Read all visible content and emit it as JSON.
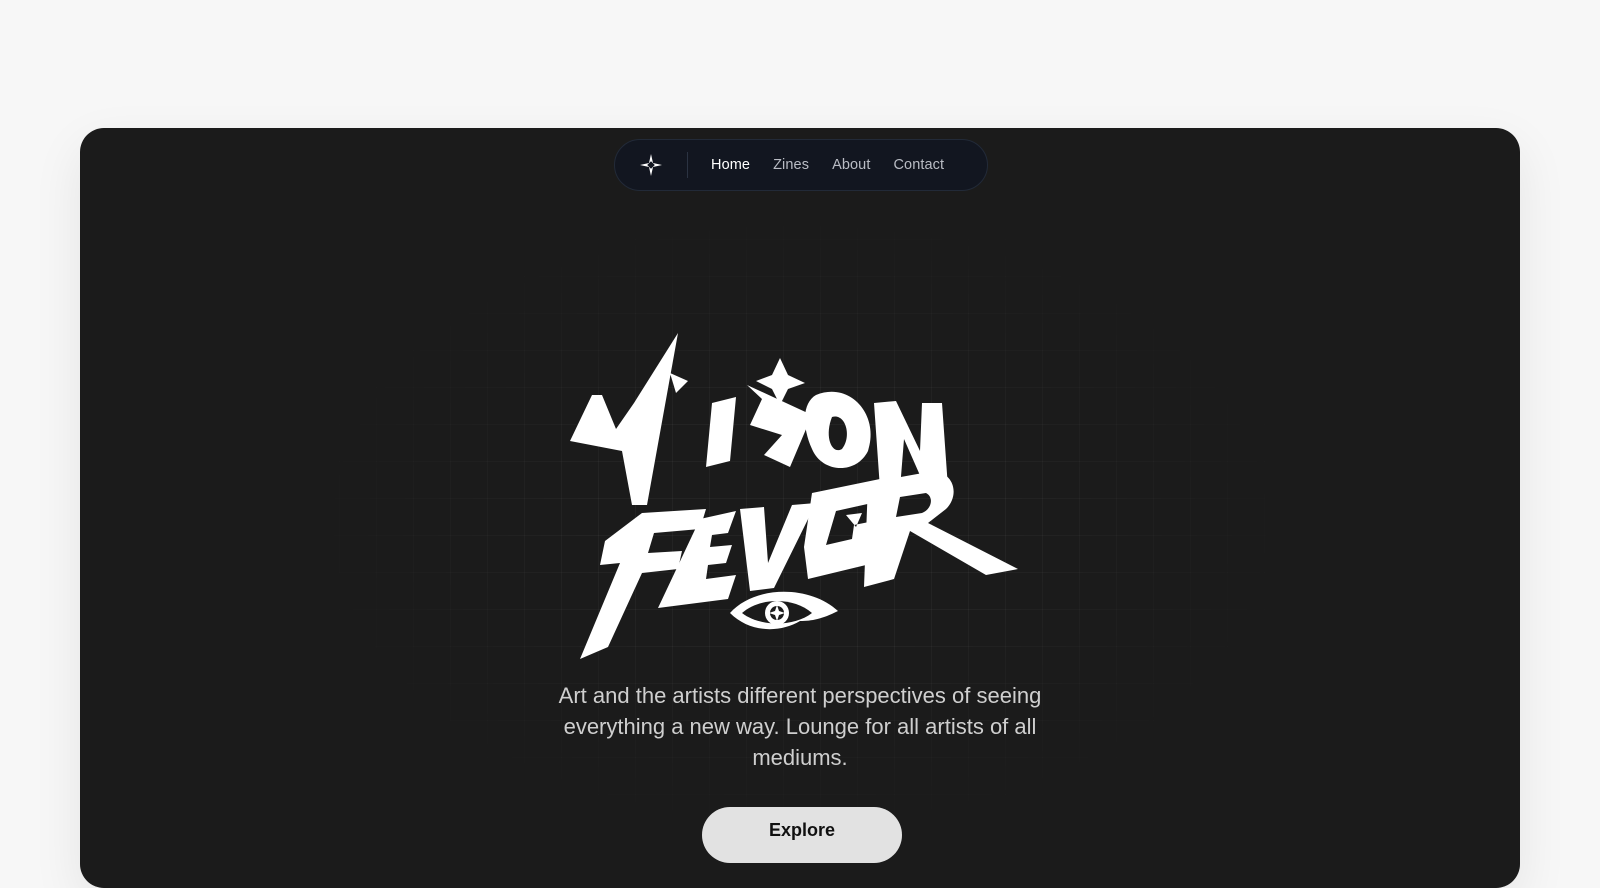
{
  "nav": {
    "logo_icon": "four-point-star-icon",
    "links": [
      {
        "label": "Home",
        "active": true
      },
      {
        "label": "Zines",
        "active": false
      },
      {
        "label": "About",
        "active": false
      },
      {
        "label": "Contact",
        "active": false
      }
    ]
  },
  "hero": {
    "logo_text": "VISION FEVER",
    "logo_icon": "eye-icon",
    "tagline": "Art and the artists different perspectives of seeing everything a new way. Lounge for all artists of all mediums.",
    "cta_label": "Explore"
  },
  "colors": {
    "page_bg": "#f7f7f7",
    "frame_bg": "#1b1b1b",
    "nav_bg": "#121620",
    "logo": "#ffffff",
    "tagline": "#cfcfcf",
    "button_bg": "#e2e2e2"
  }
}
